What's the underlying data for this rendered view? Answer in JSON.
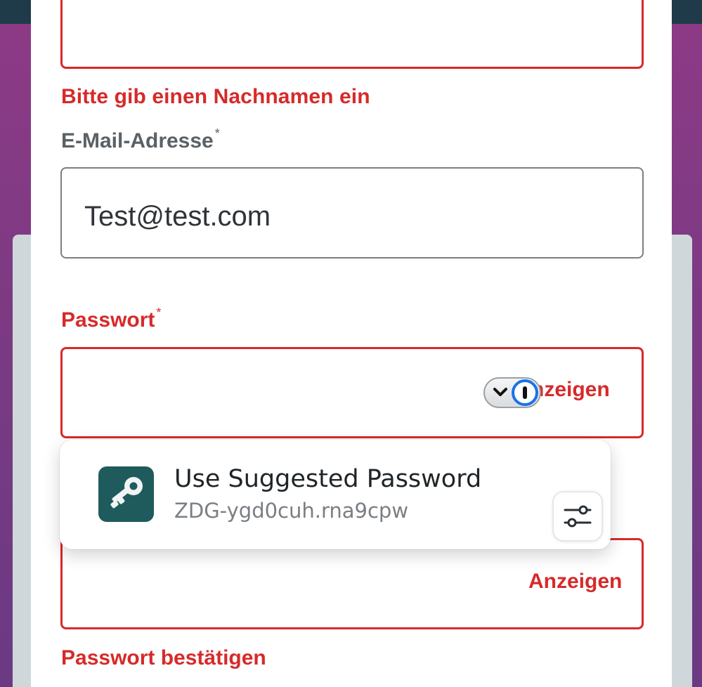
{
  "colors": {
    "accent_error": "#d62a2a",
    "label_gray": "#5a6166",
    "top_bar": "#1f3b4a",
    "key_tile": "#1f5b5d"
  },
  "form": {
    "last_name_error": "Bitte gib einen Nachnamen ein",
    "email_label": "E-Mail-Adresse",
    "email_required_mark": "*",
    "email_value": "Test@test.com",
    "password_label": "Passwort",
    "password_required_mark": "*",
    "show_password_text": "nzeigen",
    "confirm_show_text": "Anzeigen",
    "confirm_password_label": "Passwort bestätigen"
  },
  "password_manager": {
    "pill_icon": "chevron-down-icon",
    "logo_icon": "password-manager-logo-icon"
  },
  "suggestion": {
    "icon": "key-icon",
    "title": "Use Suggested Password",
    "password": "ZDG-ygd0cuh.rna9cpw",
    "settings_icon": "sliders-icon"
  }
}
